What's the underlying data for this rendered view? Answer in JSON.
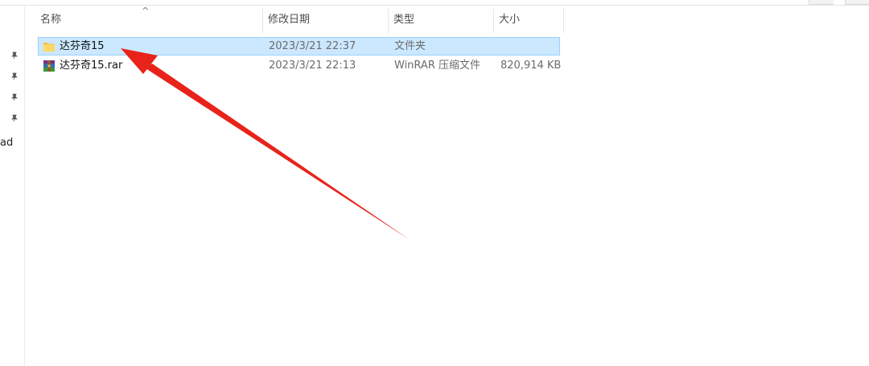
{
  "columns": {
    "name": "名称",
    "modified": "修改日期",
    "type": "类型",
    "size": "大小",
    "sort_glyph": "^"
  },
  "files": [
    {
      "name": "达芬奇15",
      "modified": "2023/3/21 22:37",
      "type": "文件夹",
      "size": "",
      "icon": "folder-icon",
      "selected": true
    },
    {
      "name": "达芬奇15.rar",
      "modified": "2023/3/21 22:13",
      "type": "WinRAR 压缩文件",
      "size": "820,914 KB",
      "icon": "winrar-archive-icon",
      "selected": false
    }
  ],
  "nav": {
    "pinned_items": 4,
    "partial_label": "ad"
  },
  "colors": {
    "selection_bg": "#cce8ff",
    "selection_border": "#99d1ff",
    "annotation_arrow": "#e8231b",
    "folder": "#f2c14e"
  },
  "annotation": {
    "type": "arrow",
    "points_to": "达芬奇15"
  }
}
